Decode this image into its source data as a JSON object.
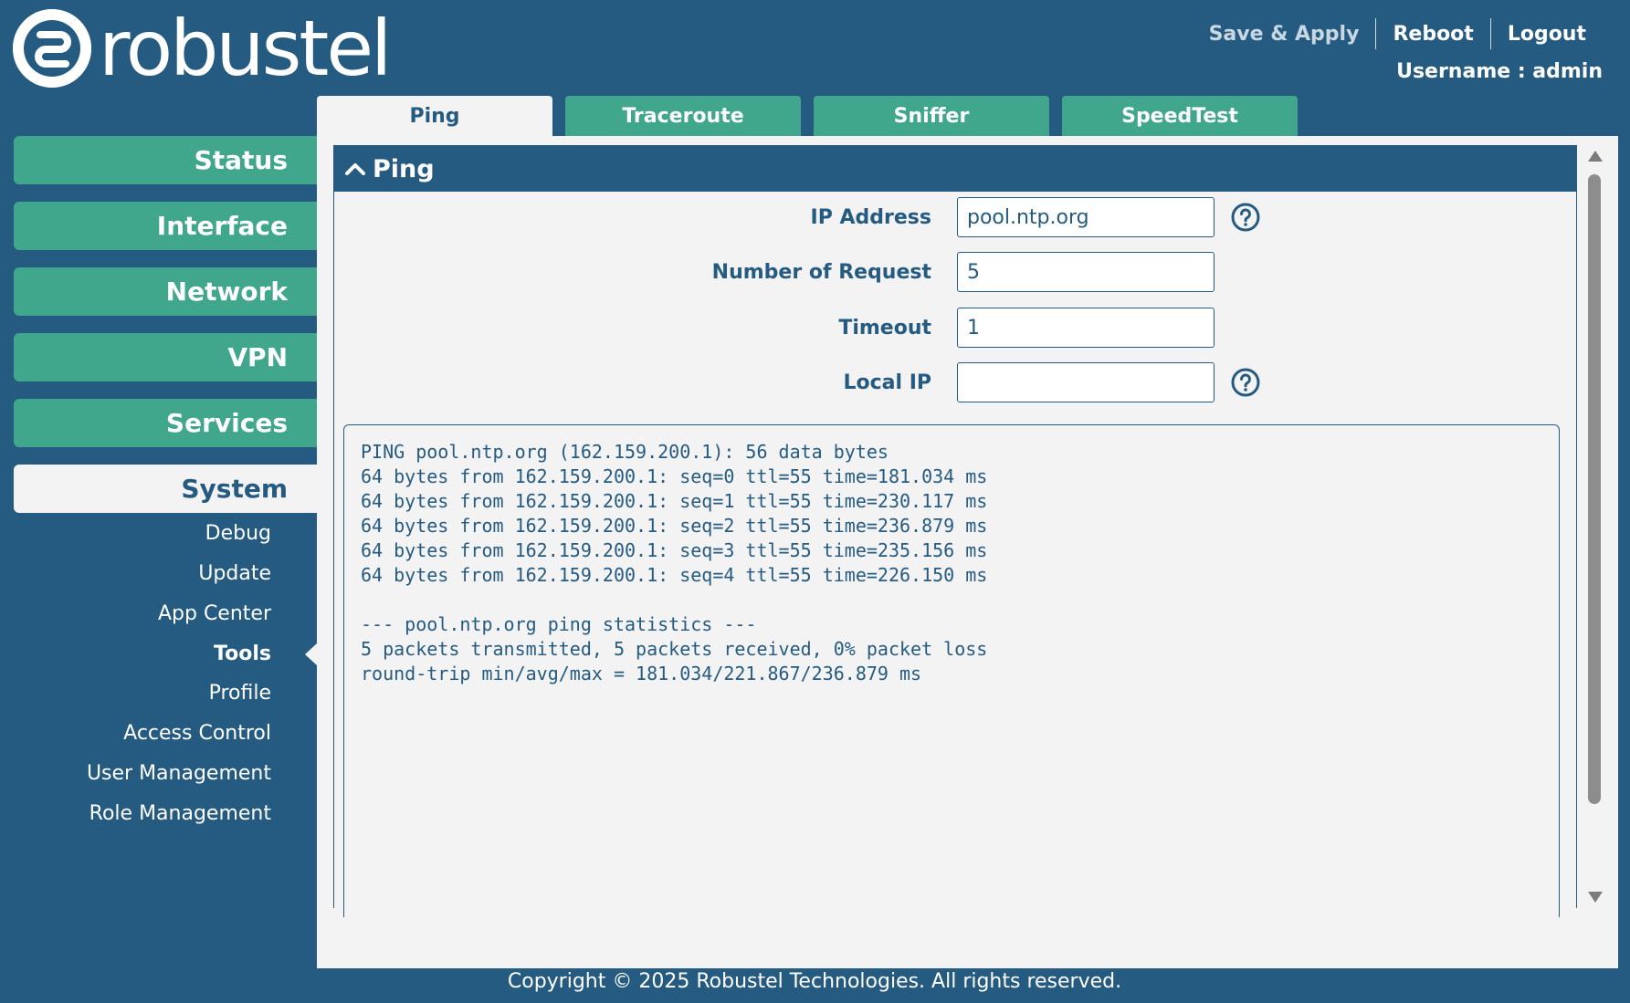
{
  "brand": {
    "logo_text": "robustel"
  },
  "header": {
    "save_apply": "Save & Apply",
    "reboot": "Reboot",
    "logout": "Logout",
    "username": "Username : admin"
  },
  "tabs": [
    {
      "label": "Ping",
      "active": true
    },
    {
      "label": "Traceroute"
    },
    {
      "label": "Sniffer"
    },
    {
      "label": "SpeedTest"
    }
  ],
  "nav": [
    {
      "label": "Status"
    },
    {
      "label": "Interface"
    },
    {
      "label": "Network"
    },
    {
      "label": "VPN"
    },
    {
      "label": "Services"
    },
    {
      "label": "System",
      "active": true
    }
  ],
  "subnav": [
    {
      "label": "Debug"
    },
    {
      "label": "Update"
    },
    {
      "label": "App Center"
    },
    {
      "label": "Tools",
      "active": true
    },
    {
      "label": "Profile"
    },
    {
      "label": "Access Control"
    },
    {
      "label": "User Management"
    },
    {
      "label": "Role Management"
    }
  ],
  "section": {
    "title": "Ping"
  },
  "form": {
    "ip_label": "IP Address",
    "ip_value": "pool.ntp.org",
    "req_label": "Number of Request",
    "req_value": "5",
    "timeout_label": "Timeout",
    "timeout_value": "1",
    "local_label": "Local IP",
    "local_value": ""
  },
  "output": "PING pool.ntp.org (162.159.200.1): 56 data bytes\n64 bytes from 162.159.200.1: seq=0 ttl=55 time=181.034 ms\n64 bytes from 162.159.200.1: seq=1 ttl=55 time=230.117 ms\n64 bytes from 162.159.200.1: seq=2 ttl=55 time=236.879 ms\n64 bytes from 162.159.200.1: seq=3 ttl=55 time=235.156 ms\n64 bytes from 162.159.200.1: seq=4 ttl=55 time=226.150 ms\n\n--- pool.ntp.org ping statistics ---\n5 packets transmitted, 5 packets received, 0% packet loss\nround-trip min/avg/max = 181.034/221.867/236.879 ms",
  "footer": "Copyright © 2025 Robustel Technologies. All rights reserved.",
  "colors": {
    "navy": "#255b80",
    "green": "#40a68c",
    "panel": "#f3f3f3"
  }
}
